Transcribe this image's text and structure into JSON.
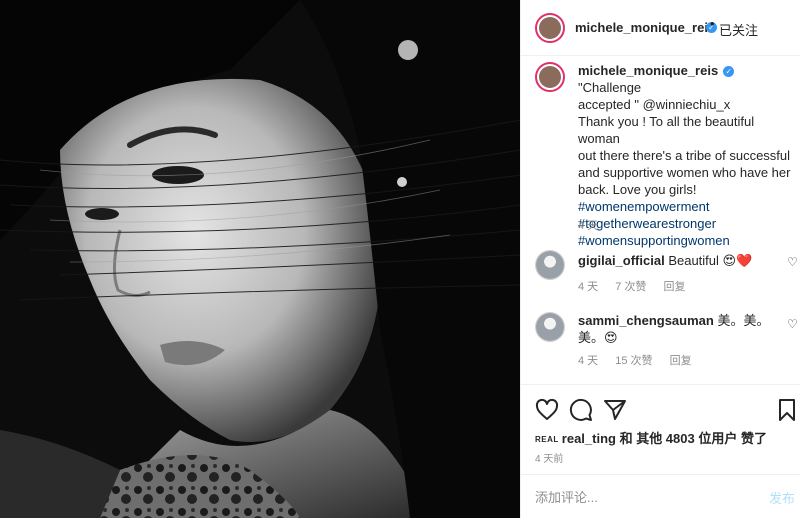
{
  "post": {
    "author": "michele_monique_reis",
    "follow_dot": "•",
    "follow_status": "已关注",
    "verified_icon": "verified-badge-icon"
  },
  "caption": {
    "author": "michele_monique_reis",
    "lines": [
      "\"Challenge",
      "accepted \" @winniechiu_x",
      "Thank you ! To all the beautiful woman",
      "out there there's a tribe of successful",
      "and supportive women who have her",
      "back. Love you girls!"
    ],
    "hashtags": [
      "#womenempowerment",
      "#togetherwearestronger",
      "#womensupportingwomen"
    ],
    "time": "4 天"
  },
  "comments": [
    {
      "user": "gigilai_official",
      "text": "Beautiful 😍❤️",
      "time": "4 天",
      "likes": "7 次赞",
      "reply": "回复"
    },
    {
      "user": "sammi_chengsauman",
      "text": "美。美。",
      "text2": "美。😍",
      "time": "4 天",
      "likes": "15 次赞",
      "reply": "回复"
    }
  ],
  "likes_line": {
    "brand": "REAL",
    "user": "real_ting",
    "rest": " 和 其他 4803 位用户 赞了"
  },
  "post_time": "4 天前",
  "comment_box": {
    "placeholder": "添加评论...",
    "post_label": "发布"
  },
  "colors": {
    "accent": "#3897f0",
    "link": "#00376b",
    "muted": "#8e8e8e",
    "post_button_disabled": "#b2dffc"
  }
}
